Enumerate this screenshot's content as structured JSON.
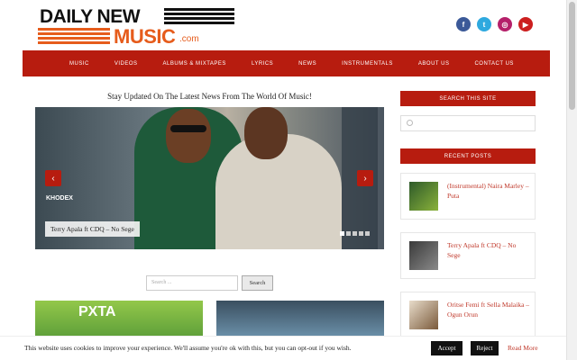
{
  "site": {
    "logo_line1": "DAILY NEW",
    "logo_line2": "MUSIC",
    "logo_suffix": ".com",
    "brand_color": "#b71c0f",
    "accent_color": "#e65c1c"
  },
  "social": [
    {
      "icon": "facebook-icon",
      "glyph": "f"
    },
    {
      "icon": "twitter-icon",
      "glyph": "t"
    },
    {
      "icon": "instagram-icon",
      "glyph": "◎"
    },
    {
      "icon": "youtube-icon",
      "glyph": "▶"
    }
  ],
  "nav": [
    "MUSIC",
    "VIDEOS",
    "ALBUMS & MIXTAPES",
    "LYRICS",
    "NEWS",
    "INSTRUMENTALS",
    "ABOUT US",
    "CONTACT US"
  ],
  "main": {
    "tagline": "Stay Updated On The Latest News From The World Of Music!",
    "slider": {
      "brand_text": "KHODEX",
      "caption": "Terry Apala ft CDQ – No Sege",
      "prev_glyph": "‹",
      "next_glyph": "›"
    },
    "search": {
      "placeholder": "Search ...",
      "button": "Search"
    },
    "thumb_left_text": "PXTA"
  },
  "sidebar": {
    "search_title": "SEARCH THIS SITE",
    "search_placeholder": "",
    "recent_title": "RECENT POSTS",
    "posts": [
      {
        "title": "(Instrumental) Naira Marley – Puta"
      },
      {
        "title": "Terry Apala ft CDQ – No Sege"
      },
      {
        "title": "Oritse Femi ft Sella Malaika – Ogun Orun"
      }
    ]
  },
  "cookie": {
    "message": "This website uses cookies to improve your experience. We'll assume you're ok with this, but you can opt-out if you wish.",
    "accept": "Accept",
    "reject": "Reject",
    "more": "Read More"
  }
}
